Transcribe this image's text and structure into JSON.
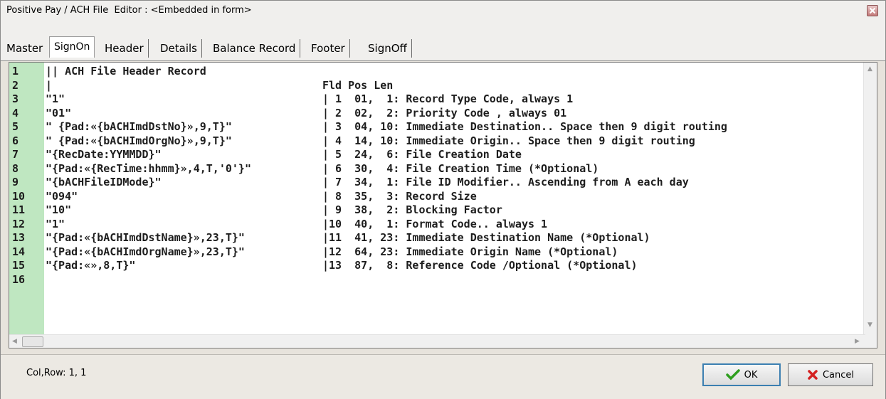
{
  "window": {
    "title": "Positive Pay / ACH File  Editor : <Embedded in form>"
  },
  "tabs": [
    {
      "label": "Master"
    },
    {
      "label": "SignOn"
    },
    {
      "label": "Header"
    },
    {
      "label": "Details"
    },
    {
      "label": "Balance Record"
    },
    {
      "label": "Footer"
    },
    {
      "label": "SignOff"
    }
  ],
  "active_tab": "SignOn",
  "editor": {
    "lines": [
      {
        "num": "1",
        "code": "|| ACH File Header Record",
        "desc": ""
      },
      {
        "num": "2",
        "code": "|",
        "desc": "Fld Pos Len"
      },
      {
        "num": "3",
        "code": "\"1\"",
        "desc": "| 1  01,  1: Record Type Code, always 1"
      },
      {
        "num": "4",
        "code": "\"01\"",
        "desc": "| 2  02,  2: Priority Code , always 01"
      },
      {
        "num": "5",
        "code": "\" {Pad:«{bACHImdDstNo}»,9,T}\"",
        "desc": "| 3  04, 10: Immediate Destination.. Space then 9 digit routing"
      },
      {
        "num": "6",
        "code": "\" {Pad:«{bACHImdOrgNo}»,9,T}\"",
        "desc": "| 4  14, 10: Immediate Origin.. Space then 9 digit routing"
      },
      {
        "num": "7",
        "code": "\"{RecDate:YYMMDD}\"",
        "desc": "| 5  24,  6: File Creation Date"
      },
      {
        "num": "8",
        "code": "\"{Pad:«{RecTime:hhmm}»,4,T,'0'}\"",
        "desc": "| 6  30,  4: File Creation Time (*Optional)"
      },
      {
        "num": "9",
        "code": "\"{bACHFileIDMode}\"",
        "desc": "| 7  34,  1: File ID Modifier.. Ascending from A each day"
      },
      {
        "num": "10",
        "code": "\"094\"",
        "desc": "| 8  35,  3: Record Size"
      },
      {
        "num": "11",
        "code": "\"10\"",
        "desc": "| 9  38,  2: Blocking Factor"
      },
      {
        "num": "12",
        "code": "\"1\"",
        "desc": "|10  40,  1: Format Code.. always 1"
      },
      {
        "num": "13",
        "code": "\"{Pad:«{bACHImdDstName}»,23,T}\"",
        "desc": "|11  41, 23: Immediate Destination Name (*Optional)"
      },
      {
        "num": "14",
        "code": "\"{Pad:«{bACHImdOrgName}»,23,T}\"",
        "desc": "|12  64, 23: Immediate Origin Name (*Optional)"
      },
      {
        "num": "15",
        "code": "\"{Pad:«»,8,T}\"",
        "desc": "|13  87,  8: Reference Code /Optional (*Optional)"
      },
      {
        "num": "16",
        "code": "",
        "desc": ""
      }
    ]
  },
  "status": {
    "text": "Col,Row: 1, 1"
  },
  "buttons": {
    "ok_label": "OK",
    "cancel_label": "Cancel"
  },
  "colors": {
    "gutter": "#bfe7c1",
    "ok_icon": "#2e9e1e",
    "cancel_icon": "#d42020"
  },
  "icons": [
    "close-icon",
    "checkmark-icon",
    "x-icon"
  ]
}
